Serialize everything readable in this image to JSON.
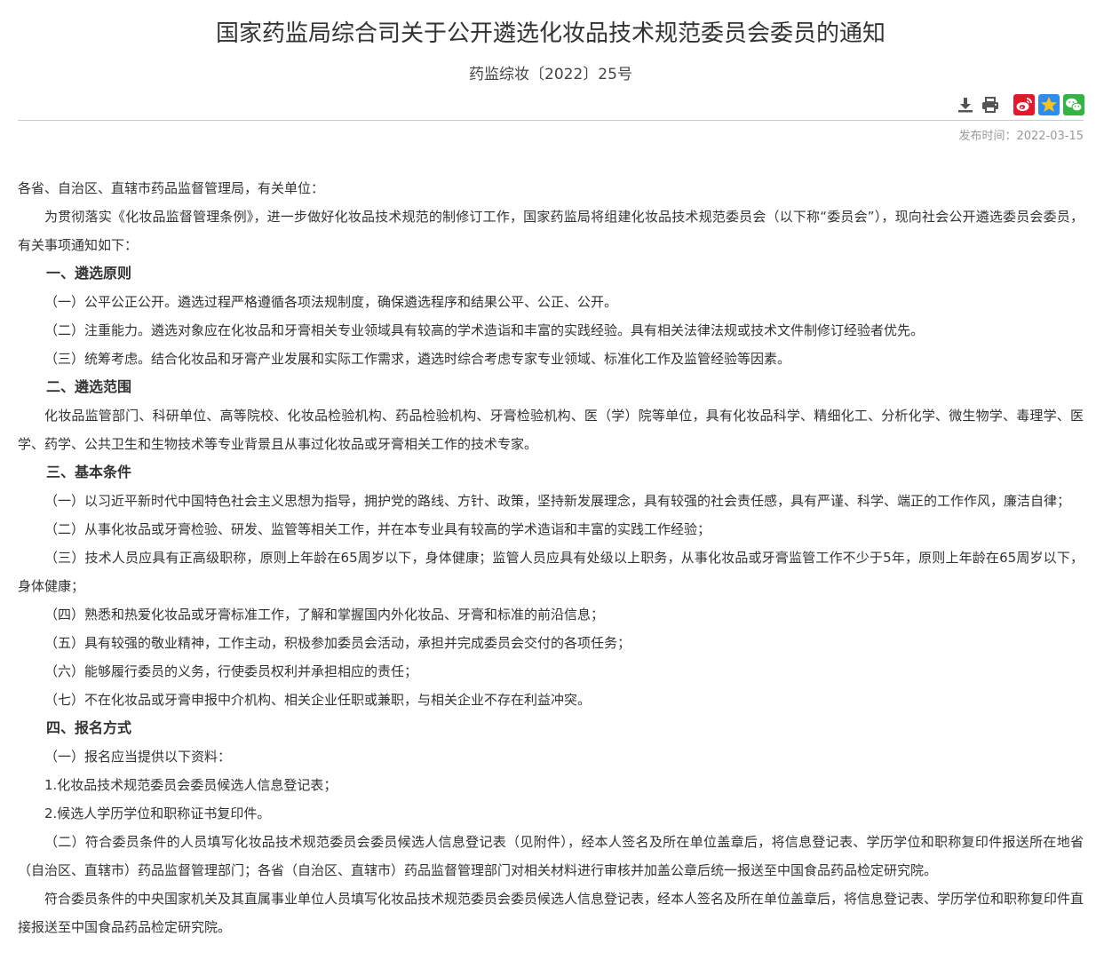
{
  "header": {
    "title": "国家药监局综合司关于公开遴选化妆品技术规范委员会委员的通知",
    "doc_number": "药监综妆〔2022〕25号"
  },
  "toolbar": {
    "download_icon": "download-icon",
    "print_icon": "print-icon",
    "share": {
      "weibo_icon": "weibo-icon",
      "qzone_icon": "qzone-star-icon",
      "wechat_icon": "wechat-icon"
    },
    "colors": {
      "tool_icon": "#555555",
      "weibo": "#e6162d",
      "qzone": "#2b8df2",
      "qzone_star": "#f8c21c",
      "wechat": "#34b543"
    }
  },
  "meta": {
    "publish_label": "发布时间：2022-03-15"
  },
  "body": {
    "salutation": "各省、自治区、直辖市药品监督管理局，有关单位：",
    "intro": "为贯彻落实《化妆品监督管理条例》，进一步做好化妆品技术规范的制修订工作，国家药监局将组建化妆品技术规范委员会（以下称“委员会”），现向社会公开遴选委员会委员，有关事项通知如下：",
    "section1": {
      "heading": "一、遴选原则",
      "items": [
        "（一）公平公正公开。遴选过程严格遵循各项法规制度，确保遴选程序和结果公平、公正、公开。",
        "（二）注重能力。遴选对象应在化妆品和牙膏相关专业领域具有较高的学术造诣和丰富的实践经验。具有相关法律法规或技术文件制修订经验者优先。",
        "（三）统筹考虑。结合化妆品和牙膏产业发展和实际工作需求，遴选时综合考虑专家专业领域、标准化工作及监管经验等因素。"
      ]
    },
    "section2": {
      "heading": "二、遴选范围",
      "text": "化妆品监管部门、科研单位、高等院校、化妆品检验机构、药品检验机构、牙膏检验机构、医（学）院等单位，具有化妆品科学、精细化工、分析化学、微生物学、毒理学、医学、药学、公共卫生和生物技术等专业背景且从事过化妆品或牙膏相关工作的技术专家。"
    },
    "section3": {
      "heading": "三、基本条件",
      "items": [
        "（一）以习近平新时代中国特色社会主义思想为指导，拥护党的路线、方针、政策，坚持新发展理念，具有较强的社会责任感，具有严谨、科学、端正的工作作风，廉洁自律；",
        "（二）从事化妆品或牙膏检验、研发、监管等相关工作，并在本专业具有较高的学术造诣和丰富的实践工作经验；",
        "（三）技术人员应具有正高级职称，原则上年龄在65周岁以下，身体健康；监管人员应具有处级以上职务，从事化妆品或牙膏监管工作不少于5年，原则上年龄在65周岁以下，身体健康；",
        "（四）熟悉和热爱化妆品或牙膏标准工作，了解和掌握国内外化妆品、牙膏和标准的前沿信息；",
        "（五）具有较强的敬业精神，工作主动，积极参加委员会活动，承担并完成委员会交付的各项任务；",
        "（六）能够履行委员的义务，行使委员权利并承担相应的责任；",
        "（七）不在化妆品或牙膏申报中介机构、相关企业任职或兼职，与相关企业不存在利益冲突。"
      ]
    },
    "section4": {
      "heading": "四、报名方式",
      "items": [
        "（一）报名应当提供以下资料：",
        "1.化妆品技术规范委员会委员候选人信息登记表；",
        "2.候选人学历学位和职称证书复印件。",
        "（二）符合委员条件的人员填写化妆品技术规范委员会委员候选人信息登记表（见附件），经本人签名及所在单位盖章后，将信息登记表、学历学位和职称复印件报送所在地省（自治区、直辖市）药品监督管理部门；各省（自治区、直辖市）药品监督管理部门对相关材料进行审核并加盖公章后统一报送至中国食品药品检定研究院。",
        "符合委员条件的中央国家机关及其直属事业单位人员填写化妆品技术规范委员会委员候选人信息登记表，经本人签名及所在单位盖章后，将信息登记表、学历学位和职称复印件直接报送至中国食品药品检定研究院。"
      ]
    }
  }
}
